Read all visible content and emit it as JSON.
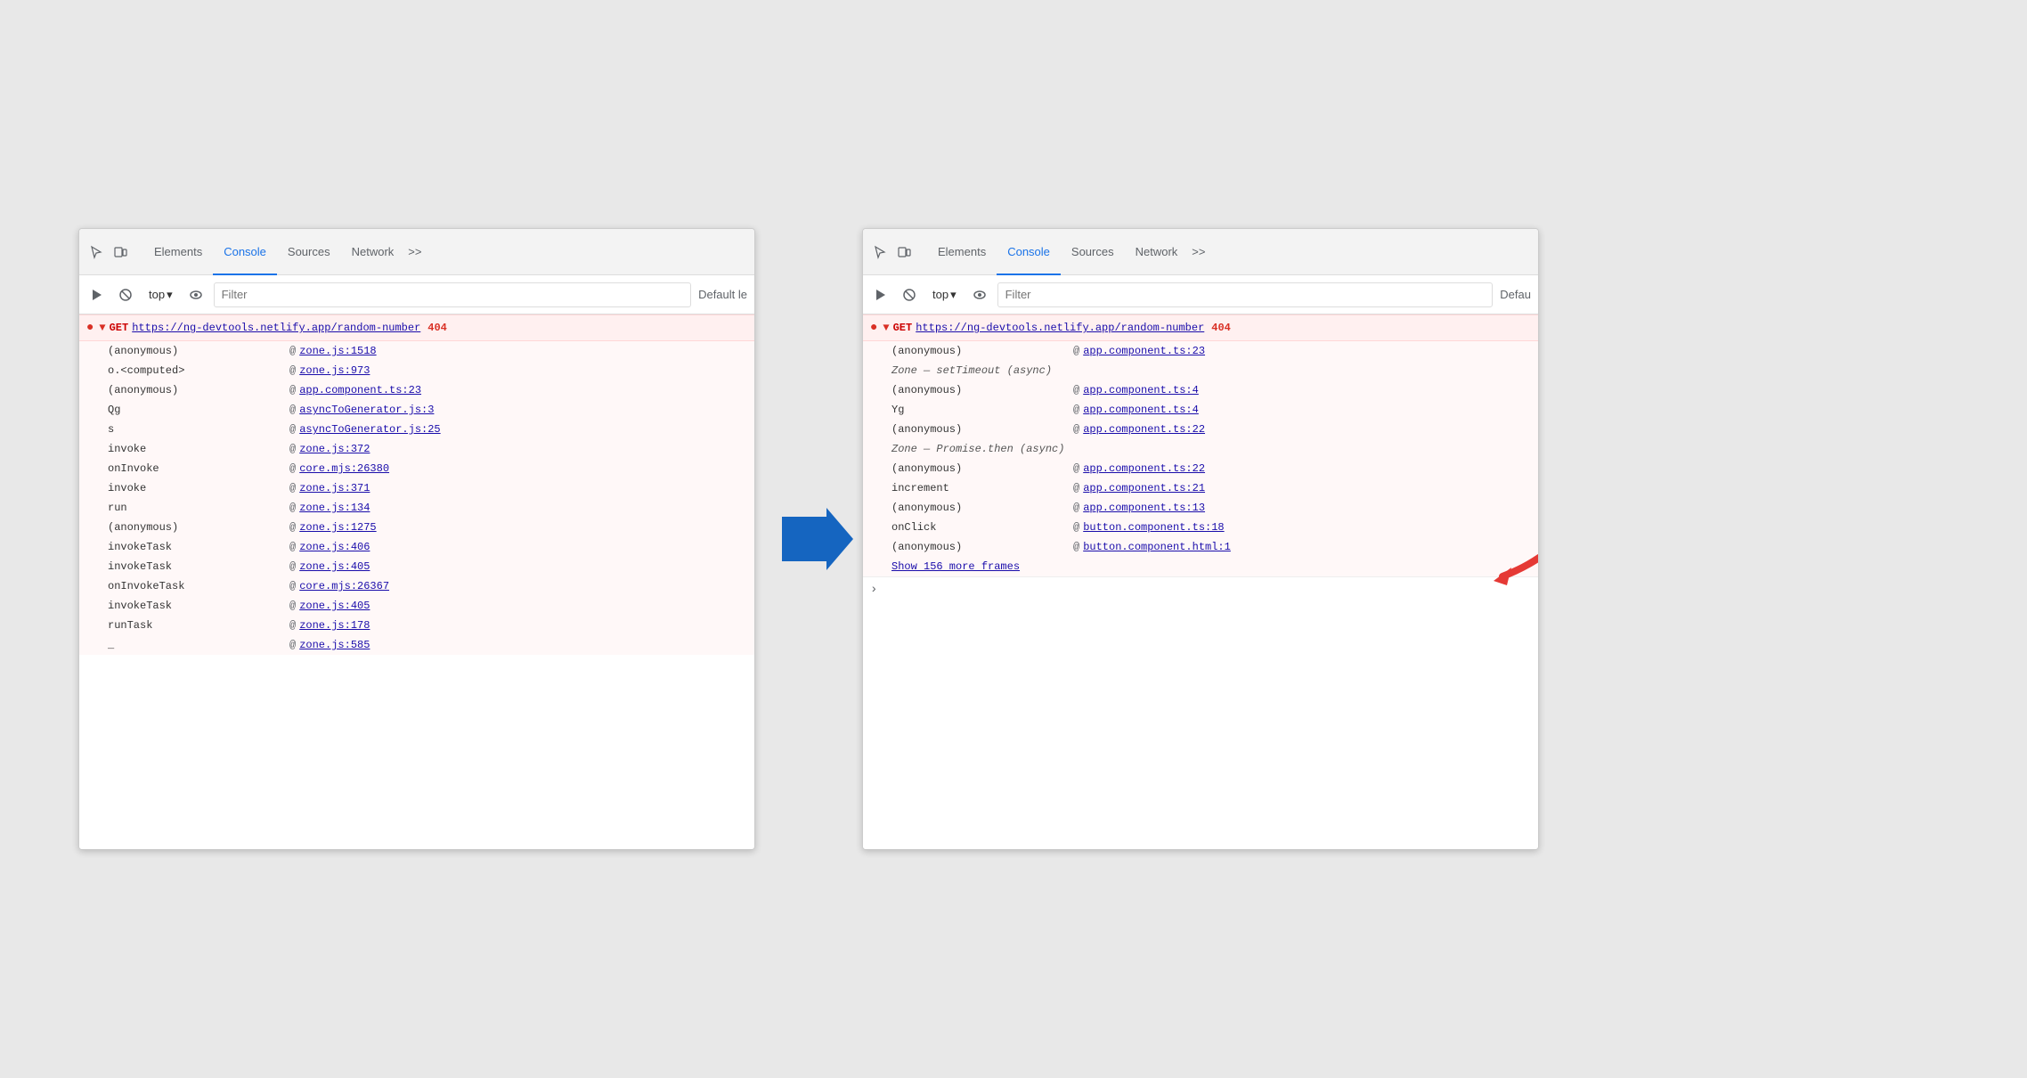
{
  "left_panel": {
    "tabs": [
      "Elements",
      "Console",
      "Sources",
      "Network",
      ">>"
    ],
    "active_tab": "Console",
    "toolbar": {
      "top_label": "top",
      "filter_placeholder": "Filter",
      "default_label": "Default le"
    },
    "error": {
      "method": "GET",
      "url": "https://ng-devtools.netlify.app/random-number",
      "status": "404"
    },
    "stack_frames": [
      {
        "fn": "(anonymous)",
        "at": "@",
        "link": "zone.js:1518"
      },
      {
        "fn": "o.<computed>",
        "at": "@",
        "link": "zone.js:973"
      },
      {
        "fn": "(anonymous)",
        "at": "@",
        "link": "app.component.ts:23"
      },
      {
        "fn": "Qg",
        "at": "@",
        "link": "asyncToGenerator.js:3"
      },
      {
        "fn": "s",
        "at": "@",
        "link": "asyncToGenerator.js:25"
      },
      {
        "fn": "invoke",
        "at": "@",
        "link": "zone.js:372"
      },
      {
        "fn": "onInvoke",
        "at": "@",
        "link": "core.mjs:26380"
      },
      {
        "fn": "invoke",
        "at": "@",
        "link": "zone.js:371"
      },
      {
        "fn": "run",
        "at": "@",
        "link": "zone.js:134"
      },
      {
        "fn": "(anonymous)",
        "at": "@",
        "link": "zone.js:1275"
      },
      {
        "fn": "invokeTask",
        "at": "@",
        "link": "zone.js:406"
      },
      {
        "fn": "invokeTask",
        "at": "@",
        "link": "zone.js:405"
      },
      {
        "fn": "onInvokeTask",
        "at": "@",
        "link": "core.mjs:26367"
      },
      {
        "fn": "invokeTask",
        "at": "@",
        "link": "zone.js:405"
      },
      {
        "fn": "runTask",
        "at": "@",
        "link": "zone.js:178"
      },
      {
        "fn": "_",
        "at": "@",
        "link": "zone.js:585"
      }
    ]
  },
  "right_panel": {
    "tabs": [
      "Elements",
      "Console",
      "Sources",
      "Network",
      ">>"
    ],
    "active_tab": "Console",
    "toolbar": {
      "top_label": "top",
      "filter_placeholder": "Filter",
      "default_label": "Defau"
    },
    "error": {
      "method": "GET",
      "url": "https://ng-devtools.netlify.app/random-number",
      "status": "404"
    },
    "stack_frames": [
      {
        "fn": "(anonymous)",
        "at": "@",
        "link": "app.component.ts:23",
        "async_before": null
      },
      {
        "fn": "Zone — setTimeout (async)",
        "is_async": true
      },
      {
        "fn": "(anonymous)",
        "at": "@",
        "link": "app.component.ts:4"
      },
      {
        "fn": "Yg",
        "at": "@",
        "link": "app.component.ts:4"
      },
      {
        "fn": "(anonymous)",
        "at": "@",
        "link": "app.component.ts:22"
      },
      {
        "fn": "Zone — Promise.then (async)",
        "is_async": true
      },
      {
        "fn": "(anonymous)",
        "at": "@",
        "link": "app.component.ts:22"
      },
      {
        "fn": "increment",
        "at": "@",
        "link": "app.component.ts:21"
      },
      {
        "fn": "(anonymous)",
        "at": "@",
        "link": "app.component.ts:13"
      },
      {
        "fn": "onClick",
        "at": "@",
        "link": "button.component.ts:18"
      },
      {
        "fn": "(anonymous)",
        "at": "@",
        "link": "button.component.html:1"
      }
    ],
    "show_more": "Show 156 more frames"
  },
  "arrow": {
    "direction": "right",
    "color": "#1565C0"
  }
}
